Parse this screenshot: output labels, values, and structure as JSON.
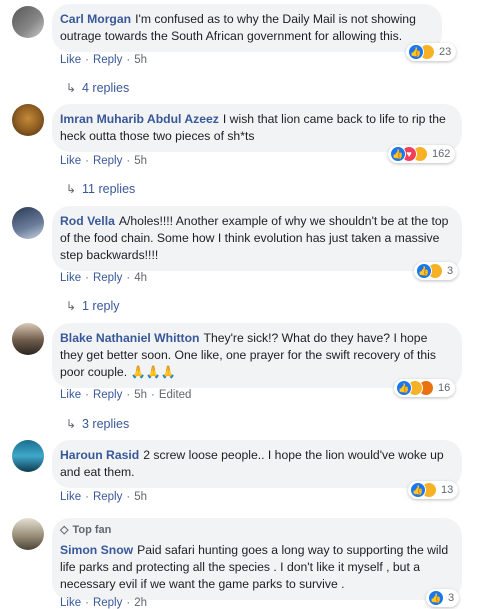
{
  "labels": {
    "like": "Like",
    "reply": "Reply",
    "edited": "Edited",
    "sep": "·"
  },
  "comments": [
    {
      "author": "Carl Morgan",
      "text": "I'm confused as to why the Daily Mail is not showing outrage towards the South African government for allowing this.",
      "time": "5h",
      "reactions": [
        "like",
        "haha"
      ],
      "count": "23",
      "replies": "4 replies"
    },
    {
      "author": "Imran Muharib Abdul Azeez",
      "text": "I wish that lion came back to life to rip the heck outta those two pieces of sh*ts",
      "time": "5h",
      "reactions": [
        "like",
        "love",
        "haha"
      ],
      "count": "162",
      "replies": "11 replies"
    },
    {
      "author": "Rod Vella",
      "text": "A/holes!!!! Another example of why we shouldn't be at the top of the food chain. Some how I think evolution has just taken a massive step backwards!!!!",
      "time": "4h",
      "reactions": [
        "like",
        "sad"
      ],
      "count": "3",
      "replies": "1 reply"
    },
    {
      "author": "Blake Nathaniel Whitton",
      "text": "They're sick!? What do they have? I hope they get better soon. One like, one prayer for the swift recovery of this poor couple. 🙏🙏🙏",
      "time": "5h",
      "edited": true,
      "reactions": [
        "like",
        "haha",
        "angry"
      ],
      "count": "16",
      "replies": "3 replies"
    },
    {
      "author": "Haroun Rasid",
      "text": "2 screw loose people.. I hope the lion would've woke up and eat them.",
      "time": "5h",
      "reactions": [
        "like",
        "haha"
      ],
      "count": "13"
    },
    {
      "author": "Simon Snow",
      "badge": "Top fan",
      "text": "Paid safari hunting goes a long way to supporting the wild life parks and protecting all the species . I don't like it myself , but a necessary evil if we want the game parks to survive .",
      "time": "2h",
      "reactions": [
        "like"
      ],
      "count": "3"
    }
  ]
}
